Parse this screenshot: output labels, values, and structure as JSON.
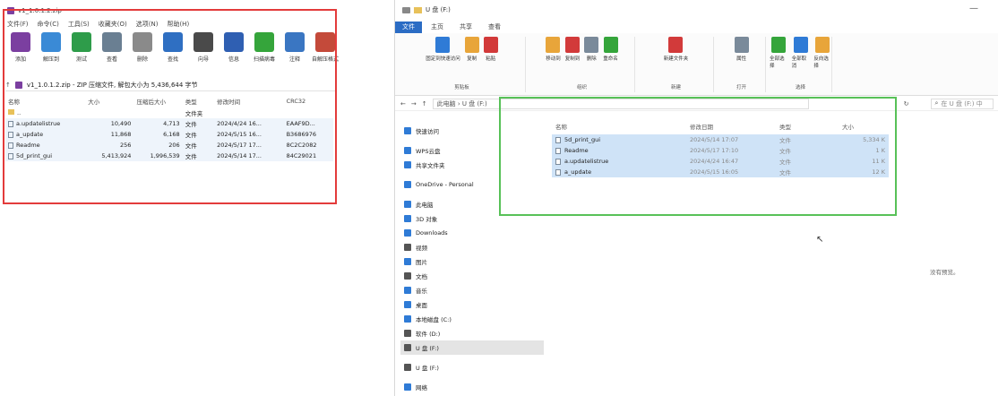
{
  "rar": {
    "title": "v1_1.0.1.2.zip",
    "menu": [
      "文件(F)",
      "命令(C)",
      "工具(S)",
      "收藏夹(O)",
      "选项(N)",
      "帮助(H)"
    ],
    "toolbar": [
      {
        "label": "添加",
        "icon": "add-icon",
        "color": "#7b3fa0"
      },
      {
        "label": "解压到",
        "icon": "extract-icon",
        "color": "#3a8ad6"
      },
      {
        "label": "测试",
        "icon": "test-icon",
        "color": "#2e9c4a"
      },
      {
        "label": "查看",
        "icon": "view-icon",
        "color": "#6a7f92"
      },
      {
        "label": "删除",
        "icon": "delete-icon",
        "color": "#8a8a8a"
      },
      {
        "label": "查找",
        "icon": "find-icon",
        "color": "#2f6fc2"
      },
      {
        "label": "向导",
        "icon": "wizard-icon",
        "color": "#4a4a4a"
      },
      {
        "label": "信息",
        "icon": "info-icon",
        "color": "#2f5fb2"
      },
      {
        "label": "扫描病毒",
        "icon": "scan-virus-icon",
        "color": "#35a53b"
      },
      {
        "label": "注释",
        "icon": "comment-icon",
        "color": "#3a76c2"
      },
      {
        "label": "自解压格式",
        "icon": "sfx-icon",
        "color": "#c44a3a"
      }
    ],
    "path": "v1_1.0.1.2.zip - ZIP 压缩文件, 解包大小为 5,436,644 字节",
    "columns": [
      "名称",
      "大小",
      "压缩后大小",
      "类型",
      "修改时间",
      "CRC32"
    ],
    "parent_row": "..",
    "parent_type": "文件夹",
    "files": [
      {
        "name": "a.updatelistrue",
        "size": "10,490",
        "packed": "4,713",
        "type": "文件",
        "modified": "2024/4/24 16...",
        "crc": "EAAF9D..."
      },
      {
        "name": "a_update",
        "size": "11,868",
        "packed": "6,168",
        "type": "文件",
        "modified": "2024/5/15 16...",
        "crc": "B3686976"
      },
      {
        "name": "Readme",
        "size": "256",
        "packed": "206",
        "type": "文件",
        "modified": "2024/5/17 17...",
        "crc": "8C2C2082"
      },
      {
        "name": "5d_print_gui",
        "size": "5,413,924",
        "packed": "1,996,539",
        "type": "文件",
        "modified": "2024/5/14 17...",
        "crc": "84C29021"
      }
    ],
    "highlight_color": "#e33b3b"
  },
  "exp": {
    "title": "U 盘 (F:)",
    "tabs": [
      "文件",
      "主页",
      "共享",
      "查看"
    ],
    "ribbon_groups": [
      {
        "label": "剪贴板",
        "buttons": [
          "固定到快速访问",
          "复制",
          "粘贴"
        ]
      },
      {
        "label": "组织",
        "buttons": [
          "移动到",
          "复制到",
          "删除",
          "重命名"
        ]
      },
      {
        "label": "新建",
        "buttons": [
          "新建文件夹"
        ]
      },
      {
        "label": "打开",
        "buttons": [
          "属性"
        ]
      },
      {
        "label": "选择",
        "buttons": [
          "全部选择",
          "全部取消",
          "反向选择"
        ]
      }
    ],
    "address": "此电脑 › U 盘 (F:)",
    "search_placeholder": "在 U 盘 (F:) 中",
    "nav": [
      {
        "label": "快速访问",
        "icon": "star-icon",
        "color": "#2f7bd6"
      },
      {
        "label": "WPS云盘",
        "icon": "cloud-icon",
        "color": "#2f7bd6"
      },
      {
        "label": "共享文件夹",
        "icon": "share-icon",
        "color": "#2f7bd6"
      },
      {
        "label": "OneDrive - Personal",
        "icon": "onedrive-icon",
        "color": "#2f7bd6"
      },
      {
        "label": "此电脑",
        "icon": "pc-icon",
        "color": "#2f7bd6"
      },
      {
        "label": "3D 对象",
        "icon": "cube-icon",
        "color": "#2f7bd6"
      },
      {
        "label": "Downloads",
        "icon": "download-icon",
        "color": "#2f7bd6"
      },
      {
        "label": "视频",
        "icon": "video-icon",
        "color": "#555555"
      },
      {
        "label": "图片",
        "icon": "picture-icon",
        "color": "#2f7bd6"
      },
      {
        "label": "文档",
        "icon": "document-icon",
        "color": "#555555"
      },
      {
        "label": "音乐",
        "icon": "music-icon",
        "color": "#2f7bd6"
      },
      {
        "label": "桌面",
        "icon": "desktop-icon",
        "color": "#2f7bd6"
      },
      {
        "label": "本地磁盘 (C:)",
        "icon": "drive-icon",
        "color": "#2f7bd6"
      },
      {
        "label": "软件 (D:)",
        "icon": "drive-icon",
        "color": "#555555"
      },
      {
        "label": "U 盘 (F:)",
        "icon": "usb-drive-icon",
        "color": "#555555"
      },
      {
        "label": "U 盘 (F:)",
        "icon": "usb-drive-icon",
        "color": "#555555"
      },
      {
        "label": "网络",
        "icon": "network-icon",
        "color": "#2f7bd6"
      }
    ],
    "selected_nav_index": 14,
    "columns": [
      "名称",
      "修改日期",
      "类型",
      "大小"
    ],
    "files": [
      {
        "name": "5d_print_gui",
        "modified": "2024/5/14 17:07",
        "type": "文件",
        "size": "5,334 K"
      },
      {
        "name": "Readme",
        "modified": "2024/5/17 17:10",
        "type": "文件",
        "size": "1 K"
      },
      {
        "name": "a.updatelistrue",
        "modified": "2024/4/24 16:47",
        "type": "文件",
        "size": "11 K"
      },
      {
        "name": "a_update",
        "modified": "2024/5/15 16:05",
        "type": "文件",
        "size": "12 K"
      }
    ],
    "status": "没有预览。",
    "highlight_color": "#58c158",
    "selection_color": "#cfe3f7"
  }
}
